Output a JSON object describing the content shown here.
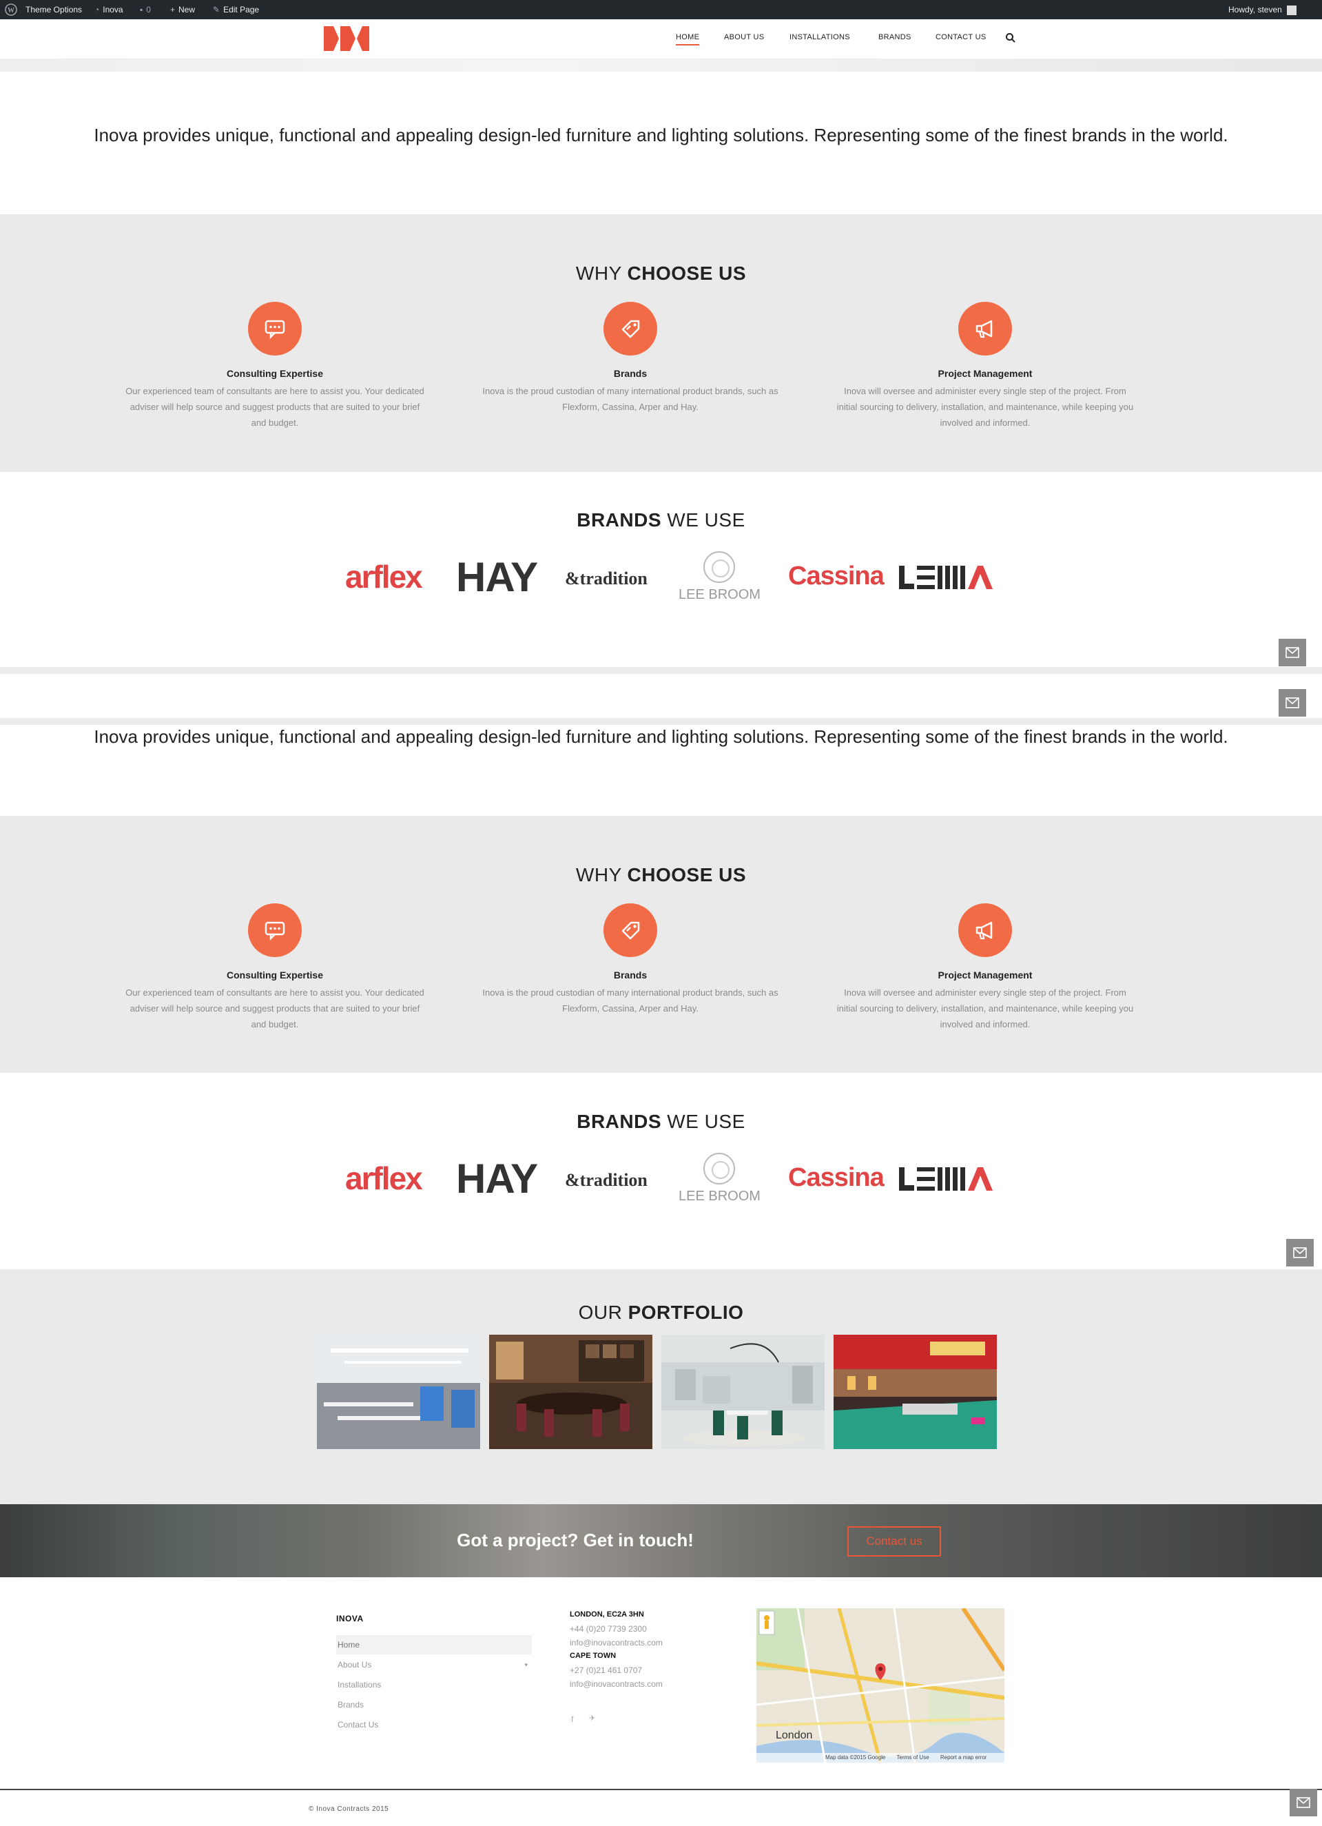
{
  "admin_bar": {
    "theme_options": "Theme Options",
    "site_name": "Inova",
    "comments_count": "0",
    "new_label": "New",
    "edit_page": "Edit Page",
    "howdy": "Howdy, steven"
  },
  "nav": {
    "items": [
      {
        "label": "HOME"
      },
      {
        "label": "ABOUT US"
      },
      {
        "label": "INSTALLATIONS"
      },
      {
        "label": "BRANDS"
      },
      {
        "label": "CONTACT US"
      }
    ]
  },
  "intro": {
    "text": "Inova provides unique, functional and appealing design-led furniture and lighting solutions. Representing some of the finest brands in the world."
  },
  "why": {
    "title_light": "WHY",
    "title_bold": "CHOOSE US",
    "features": [
      {
        "icon": "chat-bubble-icon",
        "title": "Consulting Expertise",
        "desc": "Our experienced team of consultants are here to assist you. Your dedicated adviser will help source and suggest products that are suited to your brief and budget."
      },
      {
        "icon": "tag-icon",
        "title": "Brands",
        "desc": "Inova is the proud custodian of many international product brands, such as Flexform, Cassina, Arper and Hay."
      },
      {
        "icon": "megaphone-icon",
        "title": "Project Management",
        "desc": "Inova will oversee and administer every single step of the project. From initial sourcing to delivery, installation, and maintenance, while keeping you involved and informed."
      }
    ]
  },
  "brands": {
    "title_bold": "BRANDS",
    "title_light": "WE USE",
    "logos": [
      "arflex",
      "HAY",
      "&tradition",
      "LEE BROOM",
      "Cassina",
      "LEMA"
    ]
  },
  "portfolio": {
    "title_light": "OUR",
    "title_bold": "PORTFOLIO"
  },
  "cta": {
    "text": "Got a project? Get in touch!",
    "button": "Contact us"
  },
  "footer": {
    "heading": "INOVA",
    "menu": [
      "Home",
      "About Us",
      "Installations",
      "Brands",
      "Contact Us"
    ],
    "office1_title": "LONDON, EC2A 3HN",
    "office1_phone": "+44 (0)20 7739 2300",
    "office1_email": "info@inovacontracts.com",
    "office2_title": "CAPE TOWN",
    "office2_phone": "+27 (0)21 461 0707",
    "office2_email": "info@inovacontracts.com",
    "map_city": "London",
    "map_attribution": "Map data ©2015 Google",
    "map_terms": "Terms of Use",
    "map_report": "Report a map error",
    "copyright": "© Inova Contracts 2015"
  },
  "colors": {
    "accent": "#f26b47",
    "brand_red": "#e04444",
    "band_gray": "#eaeaea",
    "admin_bar": "#23282d"
  }
}
